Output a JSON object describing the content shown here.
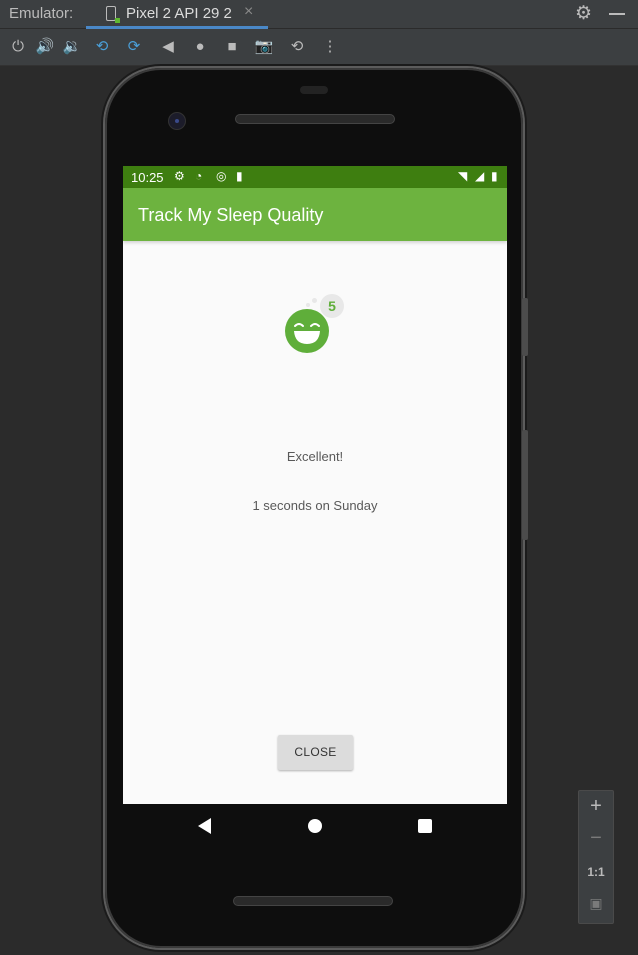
{
  "ide": {
    "panel_title": "Emulator:",
    "device_tab": "Pixel 2 API 29 2",
    "tab_close": "×"
  },
  "toolbar": {
    "icons": [
      "power-icon",
      "volume-up-icon",
      "volume-down-icon",
      "rotate-left-icon",
      "rotate-right-icon",
      "back-icon",
      "home-icon",
      "overview-icon",
      "camera-icon",
      "snapshot-icon",
      "more-icon"
    ]
  },
  "status_bar": {
    "time": "10:25"
  },
  "app": {
    "title": "Track My Sleep Quality",
    "quality_badge": "5",
    "quality_label": "Excellent!",
    "duration_text": "1 seconds on Sunday",
    "close_button": "CLOSE",
    "accent_color": "#6db33f",
    "status_bar_color": "#3e7e10"
  },
  "zoom_panel": {
    "zoom_in": "+",
    "zoom_out": "−",
    "actual_size": "1:1"
  }
}
